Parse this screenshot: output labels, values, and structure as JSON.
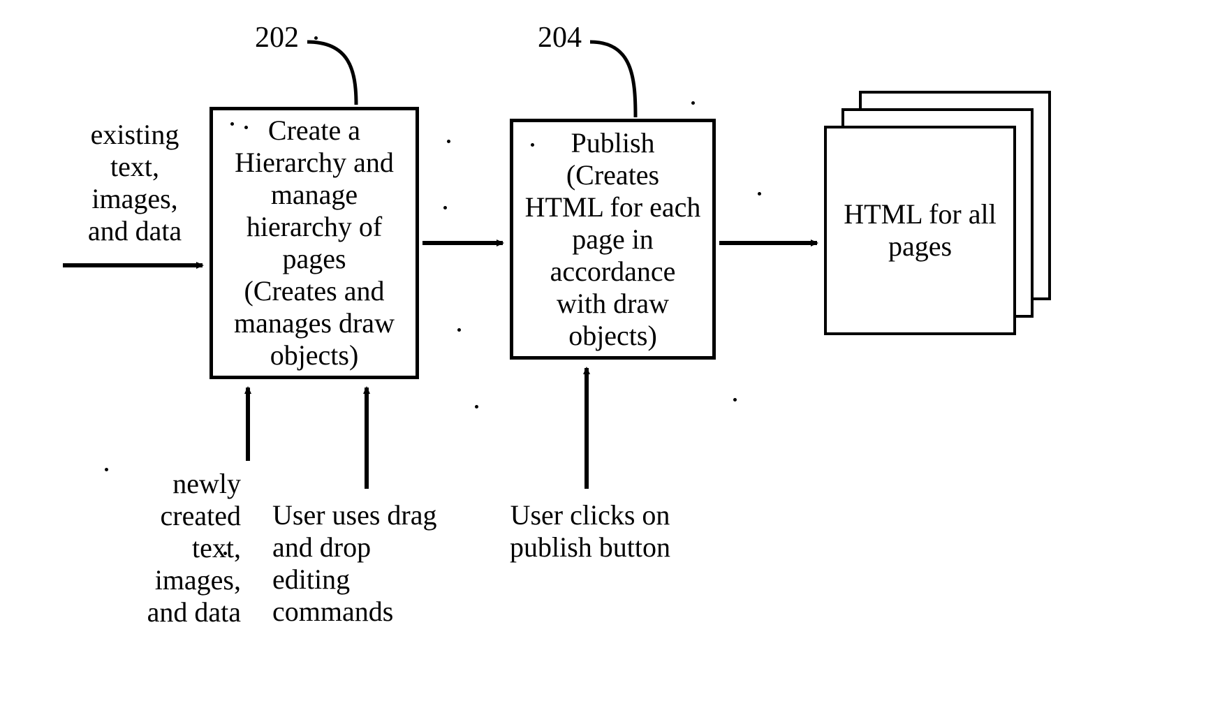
{
  "refs": {
    "ref1": "202",
    "ref2": "204"
  },
  "labels": {
    "input_left": "existing\ntext,\nimages,\nand data",
    "input_bottom_left": "newly\ncreated\ntext,\nimages,\nand data",
    "input_bottom_mid": "User uses drag\nand drop\nediting\ncommands",
    "input_publish": "User clicks on\npublish button"
  },
  "boxes": {
    "hierarchy": "Create a\nHierarchy and\nmanage\nhierarchy of\npages\n(Creates and\nmanages draw\nobjects)",
    "publish": "Publish\n(Creates\nHTML for each\npage in\naccordance\nwith  draw\nobjects)",
    "output": "HTML for all\npages"
  }
}
